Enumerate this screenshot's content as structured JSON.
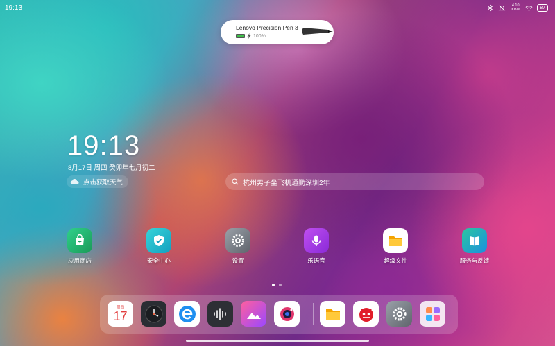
{
  "status_bar": {
    "time": "19:13",
    "network_speed": "4.10 KB/s",
    "battery": "87"
  },
  "pen_popup": {
    "name": "Lenovo Precision Pen 3",
    "battery_percent": "100%",
    "battery_level": 1.0
  },
  "lock_clock": {
    "time": "19:13",
    "date": "8月17日 周四 癸卯年七月初二",
    "weather_label": "点击获取天气"
  },
  "search": {
    "text": "杭州男子坐飞机通勤深圳2年"
  },
  "apps": [
    {
      "label": "应用商店",
      "icon": "app-store-icon",
      "color": "#2bb66a"
    },
    {
      "label": "安全中心",
      "icon": "security-center-icon",
      "color": "#1fb9c8"
    },
    {
      "label": "设置",
      "icon": "settings-icon",
      "color": "#6b6f76"
    },
    {
      "label": "乐语音",
      "icon": "voice-assistant-icon",
      "color": "#a43ee0"
    },
    {
      "label": "超级文件",
      "icon": "files-icon",
      "color": "#f6b61c"
    },
    {
      "label": "服务与反馈",
      "icon": "service-feedback-icon",
      "color": "#1aa5d6"
    }
  ],
  "page_indicator": {
    "pages": 2,
    "current": 1
  },
  "dock": [
    {
      "name": "calendar",
      "icon": "calendar-icon",
      "weekday": "周四",
      "day": "17"
    },
    {
      "name": "clock",
      "icon": "clock-icon"
    },
    {
      "name": "browser",
      "icon": "browser-icon"
    },
    {
      "name": "recorder",
      "icon": "recorder-icon"
    },
    {
      "name": "gallery",
      "icon": "gallery-icon"
    },
    {
      "name": "camera",
      "icon": "camera-icon"
    },
    {
      "name": "files",
      "icon": "files-icon"
    },
    {
      "name": "antutu",
      "icon": "antutu-icon"
    },
    {
      "name": "settings",
      "icon": "settings-icon"
    },
    {
      "name": "more-apps",
      "icon": "app-folder-icon"
    }
  ]
}
